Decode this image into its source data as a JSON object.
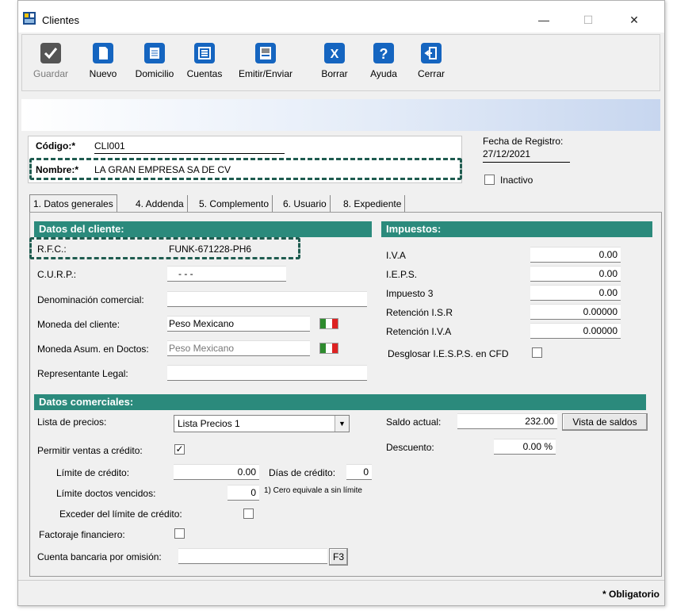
{
  "window": {
    "title": "Clientes",
    "minimize": "—",
    "maximize": "☐",
    "close": "✕"
  },
  "toolbar": {
    "save": "Guardar",
    "new": "Nuevo",
    "address": "Domicilio",
    "accounts": "Cuentas",
    "send": "Emitir/Enviar",
    "delete": "Borrar",
    "help": "Ayuda",
    "close": "Cerrar"
  },
  "header": {
    "code_label": "Código:*",
    "code_value": "CLI001",
    "name_label": "Nombre:*",
    "name_value": "LA GRAN EMPRESA SA DE CV",
    "reg_date_label": "Fecha de Registro:",
    "reg_date_value": "27/12/2021",
    "inactive_label": "Inactivo"
  },
  "tabs": [
    "1. Datos generales",
    "4. Addenda",
    "5. Complemento",
    "6. Usuario",
    "8. Expediente"
  ],
  "datos_cliente": {
    "title": "Datos del cliente:",
    "rfc_label": "R.F.C.:",
    "rfc_value": "FUNK-671228-PH6",
    "curp_label": "C.U.R.P.:",
    "curp_value": "-     -     -",
    "denominacion_label": "Denominación comercial:",
    "denominacion_value": "",
    "moneda_label": "Moneda del cliente:",
    "moneda_value": "Peso Mexicano",
    "moneda_asum_label": "Moneda Asum. en Doctos:",
    "moneda_asum_value": "Peso Mexicano",
    "representante_label": "Representante Legal:",
    "representante_value": ""
  },
  "impuestos": {
    "title": "Impuestos:",
    "iva_label": "I.V.A",
    "iva_value": "0.00",
    "ieps_label": "I.E.P.S.",
    "ieps_value": "0.00",
    "imp3_label": "Impuesto 3",
    "imp3_value": "0.00",
    "ret_isr_label": "Retención I.S.R",
    "ret_isr_value": "0.00000",
    "ret_iva_label": "Retención I.V.A",
    "ret_iva_value": "0.00000",
    "desglosar_label": "Desglosar I.E.S.P.S. en CFD"
  },
  "comerciales": {
    "title": "Datos comerciales:",
    "lista_label": "Lista de precios:",
    "lista_value": "Lista Precios 1",
    "permitir_label": "Permitir ventas a crédito:",
    "permitir_checked": "✓",
    "limite_label": "Límite de crédito:",
    "limite_value": "0.00",
    "dias_label": "Días de crédito:",
    "dias_value": "0",
    "vencidos_label": "Límite doctos vencidos:",
    "vencidos_value": "0",
    "vencidos_note": "1) Cero equivale a sin límite",
    "exceder_label": "Exceder del límite de crédito:",
    "factoraje_label": "Factoraje financiero:",
    "cuenta_label": "Cuenta bancaria por omisión:",
    "cuenta_value": "",
    "cuenta_btn": "F3",
    "saldo_label": "Saldo actual:",
    "saldo_value": "232.00",
    "saldos_btn": "Vista de saldos",
    "descuento_label": "Descuento:",
    "descuento_value": "0.00 %"
  },
  "footer": {
    "obligatorio": "* Obligatorio"
  },
  "colors": {
    "section": "#2b8a7c",
    "dashed": "#1f5c50"
  }
}
